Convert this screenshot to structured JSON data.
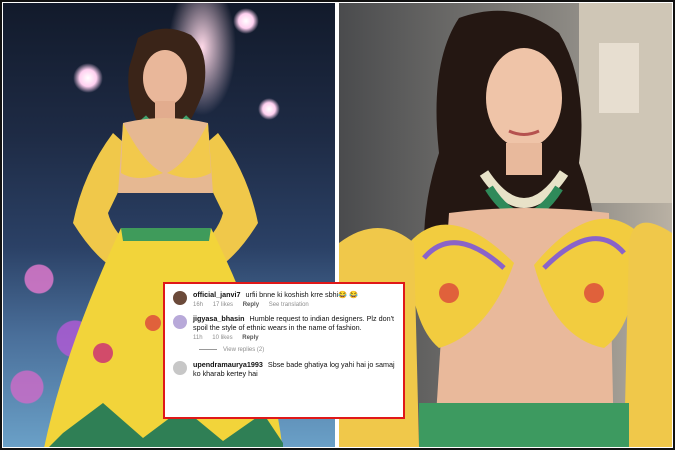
{
  "comments": [
    {
      "username": "official_janvi7",
      "text": "urfii bnne ki koshish krre sbhi😂 😂",
      "time": "16h",
      "likes": "17 likes",
      "reply_label": "Reply",
      "translation_label": "See translation",
      "avatar_color": "#6b4a3a"
    },
    {
      "username": "jigyasa_bhasin",
      "text": "Humble request to indian designers. Plz don't spoil the style of ethnic wears in the name of fashion.",
      "time": "11h",
      "likes": "10 likes",
      "reply_label": "Reply",
      "avatar_color": "#b8a9d9",
      "view_replies": "View replies (2)"
    },
    {
      "username": "upendramaurya1993",
      "text": "Sbse bade ghatiya log yahi hai jo samaj ko kharab kertey hai",
      "avatar_color": "#c7c7c7"
    }
  ],
  "colors": {
    "highlight_border": "#e01818",
    "lehenga_yellow": "#f2d43a"
  }
}
